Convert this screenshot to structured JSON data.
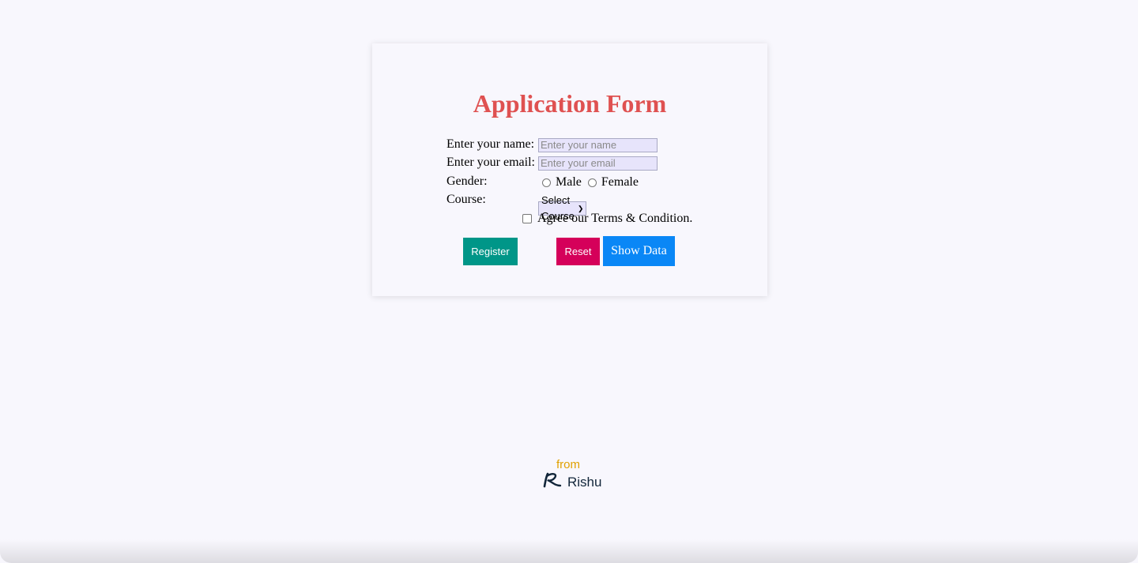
{
  "form": {
    "title": "Application Form",
    "name_label": "Enter your name:",
    "name_placeholder": "Enter your name",
    "name_value": "",
    "email_label": "Enter your email:",
    "email_placeholder": "Enter your email",
    "email_value": "",
    "gender_label": "Gender:",
    "gender_options": [
      "Male",
      "Female"
    ],
    "course_label": "Course:",
    "course_selected": "Select Course",
    "terms_label": "Agree our Terms & Condition.",
    "terms_checked": false
  },
  "buttons": {
    "register": "Register",
    "reset": "Reset",
    "show_data": "Show Data"
  },
  "colors": {
    "title": "#df5151",
    "register": "#009688",
    "reset": "#d5005a",
    "show_data": "#0a87f6"
  },
  "footer": {
    "from": "from",
    "brand": "Rishu",
    "logo_icon": "rishu-logo-icon"
  }
}
